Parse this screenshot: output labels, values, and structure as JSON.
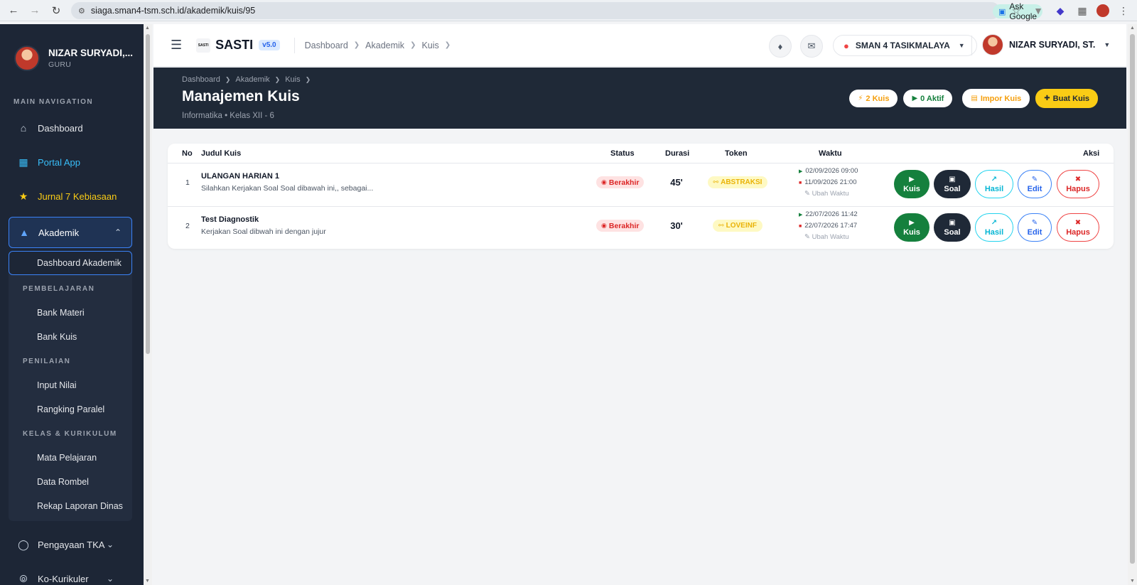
{
  "browser": {
    "url": "siaga.sman4-tsm.sch.id/akademik/kuis/95",
    "ask_google": "Ask Google"
  },
  "sidebar": {
    "user_name": "NIZAR SURYADI,...",
    "user_role": "GURU",
    "heading": "MAIN NAVIGATION",
    "items": {
      "dashboard": "Dashboard",
      "portal": "Portal App",
      "jurnal": "Jurnal 7 Kebiasaan",
      "akademik": "Akademik",
      "pengayaan": "Pengayaan TKA",
      "kokurikuler": "Ko-Kurikuler"
    },
    "akademik_sub": {
      "dashboard_akademik": "Dashboard Akademik",
      "pembelajaran_head": "PEMBELAJARAN",
      "bank_materi": "Bank Materi",
      "bank_kuis": "Bank Kuis",
      "penilaian_head": "PENILAIAN",
      "input_nilai": "Input Nilai",
      "rangking": "Rangking Paralel",
      "kelas_head": "KELAS & KURIKULUM",
      "mapel": "Mata Pelajaran",
      "rombel": "Data Rombel",
      "rekap": "Rekap Laporan Dinas"
    }
  },
  "topbar": {
    "logo_text": "SASTI",
    "brand": "SASTI",
    "version": "v5.0",
    "breadcrumb": [
      "Dashboard",
      "Akademik",
      "Kuis"
    ],
    "school": "SMAN 4 TASIKMALAYA",
    "user": "NIZAR SURYADI, ST."
  },
  "page_header": {
    "breadcrumb": [
      "Dashboard",
      "Akademik",
      "Kuis"
    ],
    "title": "Manajemen Kuis",
    "subtitle": "Informatika • Kelas XII - 6",
    "kuis_count": "2 Kuis",
    "aktif_count": "0 Aktif",
    "impor_label": "Impor Kuis",
    "buat_label": "Buat Kuis"
  },
  "table": {
    "headers": {
      "no": "No",
      "judul": "Judul Kuis",
      "status": "Status",
      "durasi": "Durasi",
      "token": "Token",
      "waktu": "Waktu",
      "aksi": "Aksi"
    },
    "rows": [
      {
        "no": "1",
        "title": "ULANGAN HARIAN 1",
        "desc": "Silahkan Kerjakan Soal Soal dibawah ini,, sebagai...",
        "status": "Berakhir",
        "duration": "45'",
        "token": "ABSTRAKSI",
        "start": "02/09/2026 09:00",
        "end": "11/09/2026 21:00",
        "change_time": "Ubah Waktu"
      },
      {
        "no": "2",
        "title": "Test Diagnostik",
        "desc": "Kerjakan Soal dibwah ini dengan jujur",
        "status": "Berakhir",
        "duration": "30'",
        "token": "LOVEINF",
        "start": "22/07/2026 11:42",
        "end": "22/07/2026 17:47",
        "change_time": "Ubah Waktu"
      }
    ],
    "actions": {
      "kuis": "Kuis",
      "soal": "Soal",
      "hasil": "Hasil",
      "edit": "Edit",
      "hapus": "Hapus"
    }
  },
  "colors": {
    "sidebar_bg": "#1d2636",
    "header_bg": "#1f2937",
    "accent_yellow": "#facc15",
    "kuis_green": "#15803d",
    "danger_red": "#dc2626",
    "link_blue": "#2563eb"
  }
}
